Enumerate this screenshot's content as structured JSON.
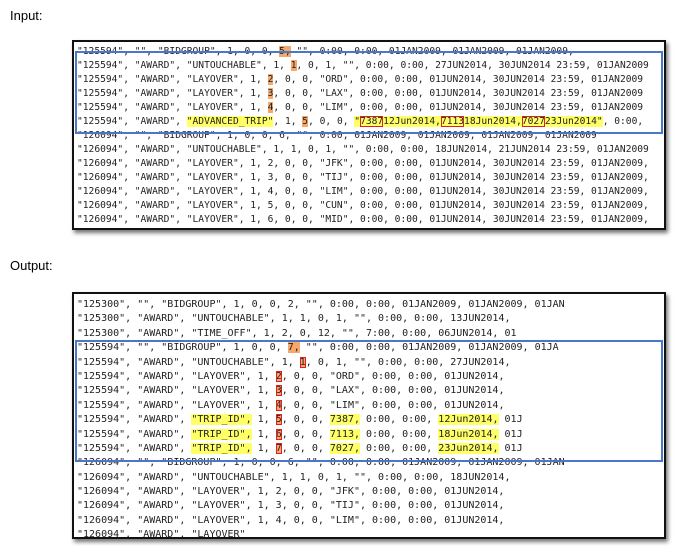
{
  "labels": {
    "input": "Input:",
    "output": "Output:"
  },
  "input_rows": [
    [
      "\"125594\", \"\", \"BIDGROUP\", 1, 0, 0, ",
      {
        "t": "5,",
        "h": "o"
      },
      " \"\", 0:00, 0:00, 01JAN2009, 01JAN2009, 01JAN2009,"
    ],
    [
      "\"125594\", \"AWARD\", \"UNTOUCHABLE\", 1, ",
      {
        "t": "1",
        "h": "o"
      },
      ", 0, 1, \"\", 0:00, 0:00, 27JUN2014, 30JUN2014 23:59, 01JAN2009"
    ],
    [
      "\"125594\", \"AWARD\", \"LAYOVER\", 1, ",
      {
        "t": "2",
        "h": "o"
      },
      ", 0, 0, \"ORD\", 0:00, 0:00, 01JUN2014, 30JUN2014 23:59, 01JAN2009"
    ],
    [
      "\"125594\", \"AWARD\", \"LAYOVER\", 1, ",
      {
        "t": "3",
        "h": "o"
      },
      ", 0, 0, \"LAX\", 0:00, 0:00, 01JUN2014, 30JUN2014 23:59, 01JAN2009"
    ],
    [
      "\"125594\", \"AWARD\", \"LAYOVER\", 1, ",
      {
        "t": "4",
        "h": "o"
      },
      ", 0, 0, \"LIM\", 0:00, 0:00, 01JUN2014, 30JUN2014 23:59, 01JAN2009"
    ],
    [
      "\"125594\", \"AWARD\", ",
      {
        "t": "\"ADVANCED_TRIP\"",
        "h": "y"
      },
      ", 1, ",
      {
        "t": "5",
        "h": "o"
      },
      ", 0, 0, ",
      {
        "t": "\"",
        "h": "y"
      },
      {
        "t": "7387",
        "h": "y",
        "b": true
      },
      {
        "t": "12Jun2014,",
        "h": "y"
      },
      {
        "t": "7113",
        "h": "y",
        "b": true
      },
      {
        "t": "18Jun2014,",
        "h": "y"
      },
      {
        "t": "7027",
        "h": "y",
        "b": true
      },
      {
        "t": "23Jun2014\"",
        "h": "y"
      },
      ", 0:00,"
    ],
    [
      "\"126094\", \"\", \"BIDGROUP\", 1, 0, 0, 6, \"\", 0:00, 01JAN2009, 01JAN2009, 01JAN2009, 01JAN2009"
    ],
    [
      "\"126094\", \"AWARD\", \"UNTOUCHABLE\", 1, 1, 0, 1, \"\", 0:00, 0:00, 18JUN2014, 21JUN2014 23:59, 01JAN2009"
    ],
    [
      "\"126094\", \"AWARD\", \"LAYOVER\", 1, 2, 0, 0, \"JFK\", 0:00, 0:00, 01JUN2014, 30JUN2014 23:59, 01JAN2009,"
    ],
    [
      "\"126094\", \"AWARD\", \"LAYOVER\", 1, 3, 0, 0, \"TIJ\", 0:00, 0:00, 01JUN2014, 30JUN2014 23:59, 01JAN2009,"
    ],
    [
      "\"126094\", \"AWARD\", \"LAYOVER\", 1, 4, 0, 0, \"LIM\", 0:00, 0:00, 01JUN2014, 30JUN2014 23:59, 01JAN2009,"
    ],
    [
      "\"126094\", \"AWARD\", \"LAYOVER\", 1, 5, 0, 0, \"CUN\", 0:00, 0:00, 01JUN2014, 30JUN2014 23:59, 01JAN2009,"
    ],
    [
      "\"126094\", \"AWARD\", \"LAYOVER\", 1, 6, 0, 0, \"MID\", 0:00, 0:00, 01JUN2014, 30JUN2014 23:59, 01JAN2009,"
    ]
  ],
  "output_rows": [
    [
      "\"125300\",  \"\",  \"BIDGROUP\",  1,  0,  0, 2,  \"\",  0:00,  0:00,  01JAN2009,  01JAN2009,  01JAN"
    ],
    [
      "\"125300\",  \"AWARD\",  \"UNTOUCHABLE\",  1,  1,  0,  1,  \"\",  0:00,  0:00,  13JUN2014,"
    ],
    [
      "\"125300\",  \"AWARD\",  \"TIME_OFF\",  1,  2,  0,  12,  \"\",  7:00,  0:00,  06JUN2014,  01"
    ],
    [
      "\"125594\",  \"\",  \"BIDGROUP\",  1,  0,  0, ",
      {
        "t": "7,",
        "h": "o"
      },
      "  \"\",  0:00,  0:00,  01JAN2009,  01JAN2009,  01JA"
    ],
    [
      "\"125594\",  \"AWARD\",  \"UNTOUCHABLE\",  1, ",
      {
        "t": "1",
        "h": "o",
        "b": true
      },
      ",  0,  1,  \"\",  0:00,  0:00,  27JUN2014,"
    ],
    [
      "\"125594\",  \"AWARD\",  \"LAYOVER\",  1, ",
      {
        "t": "2",
        "h": "o",
        "b": true
      },
      ",  0,  0,  \"ORD\",  0:00,  0:00,  01JUN2014,"
    ],
    [
      "\"125594\",  \"AWARD\",  \"LAYOVER\",  1, ",
      {
        "t": "3",
        "h": "o",
        "b": true
      },
      ",  0,  0,  \"LAX\",  0:00,  0:00,  01JUN2014,"
    ],
    [
      "\"125594\",  \"AWARD\",  \"LAYOVER\",  1, ",
      {
        "t": "4",
        "h": "o",
        "b": true
      },
      ",  0,  0,  \"LIM\",  0:00,  0:00,  01JUN2014,"
    ],
    [
      "\"125594\",  \"AWARD\",  ",
      {
        "t": "\"TRIP_ID\",",
        "h": "y"
      },
      "  1, ",
      {
        "t": "5",
        "h": "o",
        "b": true
      },
      ",  0,  0,  ",
      {
        "t": "7387,",
        "h": "y"
      },
      "  0:00,  0:00,  ",
      {
        "t": "12Jun2014,",
        "h": "y"
      },
      "  01J"
    ],
    [
      "\"125594\",  \"AWARD\",  ",
      {
        "t": "\"TRIP_ID\",",
        "h": "y"
      },
      "  1, ",
      {
        "t": "6",
        "h": "o",
        "b": true
      },
      ",  0,  0,  ",
      {
        "t": "7113,",
        "h": "y"
      },
      "  0:00,  0:00,  ",
      {
        "t": "18Jun2014,",
        "h": "y"
      },
      "  01J"
    ],
    [
      "\"125594\",  \"AWARD\",  ",
      {
        "t": "\"TRIP_ID\",",
        "h": "y"
      },
      "  1, ",
      {
        "t": "7",
        "h": "o",
        "b": true
      },
      ",  0,  0,  ",
      {
        "t": "7027,",
        "h": "y"
      },
      "  0:00,  0:00,  ",
      {
        "t": "23Jun2014,",
        "h": "y"
      },
      "  01J"
    ],
    [
      "\"126094\",  \"\",  \"BIDGROUP\",  1,  0,  0,  6,  \"\",  0:00,  0:00,  01JAN2009,  01JAN2009,  01JAN"
    ],
    [
      "\"126094\",  \"AWARD\",  \"UNTOUCHABLE\",  1,  1,  0,  1,  \"\",  0:00,  0:00,  18JUN2014,"
    ],
    [
      "\"126094\",  \"AWARD\",  \"LAYOVER\",  1,  2,  0,  0,  \"JFK\",  0:00,  0:00,  01JUN2014,"
    ],
    [
      "\"126094\",  \"AWARD\",  \"LAYOVER\",  1,  3,  0,  0,  \"TIJ\",  0:00,  0:00,  01JUN2014,"
    ],
    [
      "\"126094\",  \"AWARD\",  \"LAYOVER\",  1,  4,  0,  0,  \"LIM\",  0:00,  0:00,  01JUN2014,"
    ],
    [
      "\"126094\",  \"AWARD\",  \"LAYOVER\""
    ]
  ],
  "colors": {
    "highlight_orange": "#f5a86a",
    "highlight_yellow": "#ffff66",
    "box_red": "#e02020",
    "frame_blue": "#4a78c9"
  }
}
